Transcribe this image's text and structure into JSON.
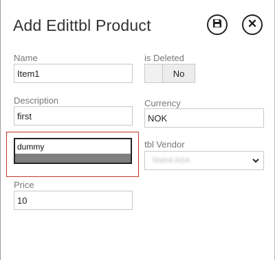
{
  "header": {
    "title": "Add Edittbl Product"
  },
  "icons": {
    "save": "save-icon",
    "close": "close-icon",
    "dropdown": "chevron-down-icon"
  },
  "form": {
    "name": {
      "label": "Name",
      "value": "Item1"
    },
    "is_deleted": {
      "label": "is Deleted",
      "state": "No"
    },
    "description": {
      "label": "Description",
      "value": "first"
    },
    "currency": {
      "label": "Currency",
      "value": "NOK"
    },
    "dummy": {
      "value": "dummy"
    },
    "vendor": {
      "label": "tbl Vendor",
      "value": "Statoil ASA"
    },
    "price": {
      "label": "Price",
      "value": "10"
    }
  },
  "colors": {
    "highlight": "#c0392b",
    "border": "#c8c8c8"
  }
}
